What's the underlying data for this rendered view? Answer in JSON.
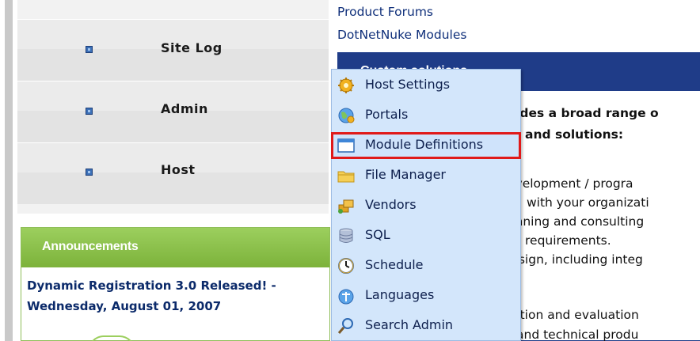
{
  "nav": {
    "items": [
      {
        "label": "Site Log"
      },
      {
        "label": "Admin"
      },
      {
        "label": "Host"
      }
    ]
  },
  "announcements": {
    "title": "Announcements",
    "item_text": "Dynamic Registration 3.0 Released! - Wednesday, August 01, 2007"
  },
  "top_links": [
    "Product Forums",
    "DotNetNuke Modules"
  ],
  "custom_solutions": {
    "title": "Custom solutions",
    "lines": [
      "vides a broad range o",
      "and solutions:",
      "evelopment / progra",
      "with your organizati",
      "anning and consulting",
      "requirements.",
      "lesign, including integ",
      "tation and evaluation",
      "and technical produ"
    ]
  },
  "host_menu": {
    "items": [
      {
        "label": "Host Settings",
        "icon": "gear-icon"
      },
      {
        "label": "Portals",
        "icon": "globe-icon"
      },
      {
        "label": "Module Definitions",
        "icon": "window-icon"
      },
      {
        "label": "File Manager",
        "icon": "folder-icon"
      },
      {
        "label": "Vendors",
        "icon": "vendors-icon"
      },
      {
        "label": "SQL",
        "icon": "database-icon"
      },
      {
        "label": "Schedule",
        "icon": "clock-icon"
      },
      {
        "label": "Languages",
        "icon": "languages-icon"
      },
      {
        "label": "Search Admin",
        "icon": "magnifier-icon"
      }
    ],
    "highlighted_item": "Module Definitions"
  },
  "colors": {
    "nav_bullet": "#3b6fb6",
    "announcements_green": "#8cc34b",
    "panel_blue": "#1f3c88",
    "menu_bg": "#d3e6fb",
    "highlight_red": "#e01919"
  }
}
